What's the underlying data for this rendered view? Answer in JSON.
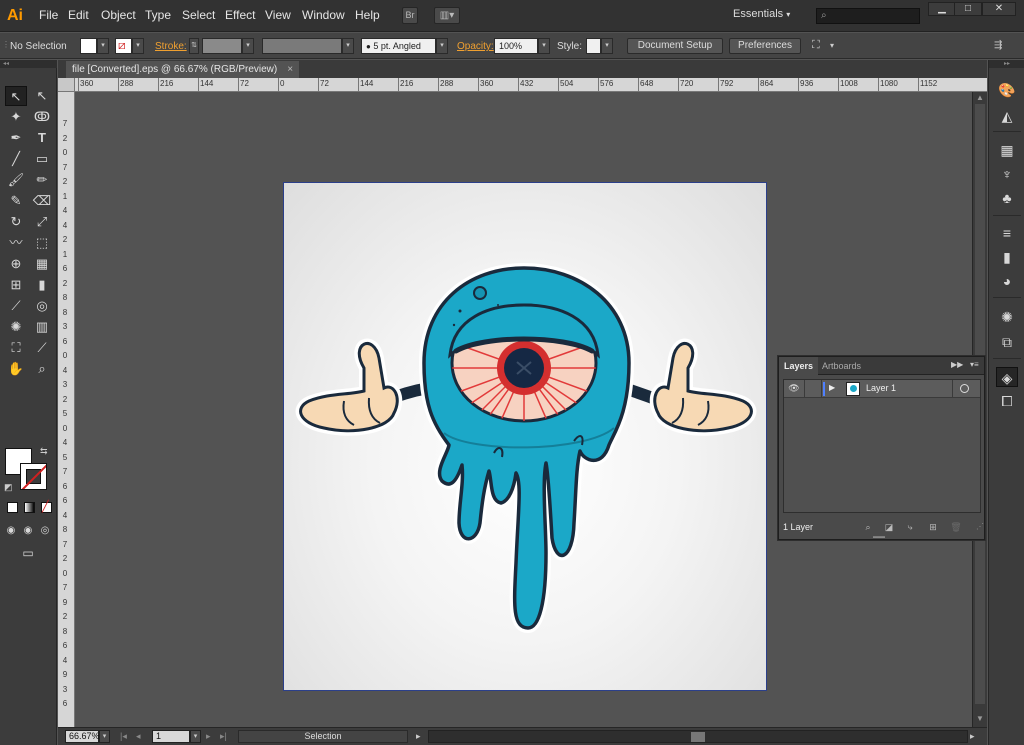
{
  "app": {
    "logo": "Ai",
    "menus": [
      "File",
      "Edit",
      "Object",
      "Type",
      "Select",
      "Effect",
      "View",
      "Window",
      "Help"
    ],
    "bridge_label": "Br",
    "workspace": "Essentials",
    "window_buttons": {
      "minimize": "▁",
      "maximize": "□",
      "close": "✕"
    }
  },
  "control_bar": {
    "selection_status": "No Selection",
    "stroke_label": "Stroke:",
    "brush_value": "5 pt. Angled",
    "opacity_label": "Opacity:",
    "opacity_value": "100%",
    "style_label": "Style:",
    "document_setup": "Document Setup",
    "preferences": "Preferences"
  },
  "document": {
    "tab_title": "file [Converted].eps @ 66.67% (RGB/Preview)",
    "tab_close": "×",
    "ruler_top_ticks": [
      "360",
      "288",
      "216",
      "144",
      "72",
      "0",
      "72",
      "144",
      "216",
      "288",
      "360",
      "432",
      "504",
      "576",
      "648",
      "720",
      "792",
      "864",
      "936",
      "1008",
      "1080",
      "1152"
    ],
    "ruler_left_labels": [
      "7",
      "2",
      "0",
      "7",
      "2",
      "1",
      "4",
      "4",
      "2",
      "1",
      "6",
      "2",
      "8",
      "8",
      "3",
      "6",
      "0",
      "4",
      "3",
      "2",
      "5",
      "0",
      "4",
      "5",
      "7",
      "6",
      "6",
      "4",
      "8",
      "7",
      "2",
      "0",
      "7",
      "9",
      "2",
      "8",
      "6",
      "4",
      "9",
      "3",
      "6"
    ]
  },
  "status_bar": {
    "zoom": "66.67%",
    "artboard_number": "1",
    "current_tool": "Selection"
  },
  "layers_panel": {
    "tabs": [
      "Layers",
      "Artboards"
    ],
    "layers": [
      {
        "name": "Layer 1",
        "color": "#4f80ff"
      }
    ],
    "count_text": "1 Layer"
  },
  "colors": {
    "accent": "#ff9a00",
    "ink": "#1a2a3c",
    "cyan": "#1ba8c8",
    "iris": "#152844",
    "skin": "#f7d9b4",
    "vein_red": "#e23a3a",
    "sclera": "#f7d2c1"
  }
}
